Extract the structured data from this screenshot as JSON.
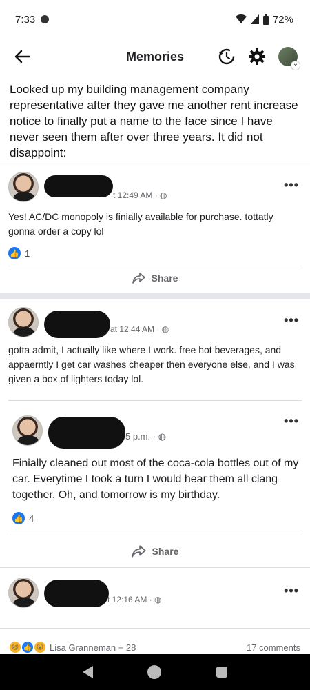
{
  "status_bar": {
    "time": "7:33",
    "battery": "72%"
  },
  "app_bar": {
    "title": "Memories"
  },
  "post": {
    "text": "Looked up my building management company representative after they gave me another rent increase notice to finally put a name to the face since I have never seen them after over three years.  It did not disappoint:"
  },
  "entries": [
    {
      "timestamp": "t 12:49 AM · ",
      "text": "Yes! AC/DC monopoly is finially available for purchase. tottatly gonna order a copy lol",
      "reaction_count": "1",
      "share_label": "Share"
    },
    {
      "timestamp": "at 12:44 AM · ",
      "text": "gotta admit, I actually like where I work. free hot beverages, and appaerntly I get car washes cheaper then everyone else, and I was given a box of lighters today lol."
    },
    {
      "timestamp": "5 p.m. · ",
      "text": "Finially cleaned out most of the coca-cola bottles out of my car. Everytime I took a turn I would hear them all clang together. Oh, and tomorrow is my birthday.",
      "reaction_count": "4",
      "share_label": "Share"
    },
    {
      "timestamp": "t 12:16 AM · "
    }
  ],
  "footer": {
    "reactors": "Lisa Granneman + 28",
    "comments": "17 comments"
  },
  "icons": {
    "back": "arrow-left-icon",
    "history": "history-icon",
    "settings": "gear-icon",
    "more": "more-dots-icon",
    "globe": "globe-icon",
    "share": "share-icon",
    "like": "like-icon"
  },
  "colors": {
    "like_blue": "#1877f2",
    "divider": "#e4e6eb"
  }
}
